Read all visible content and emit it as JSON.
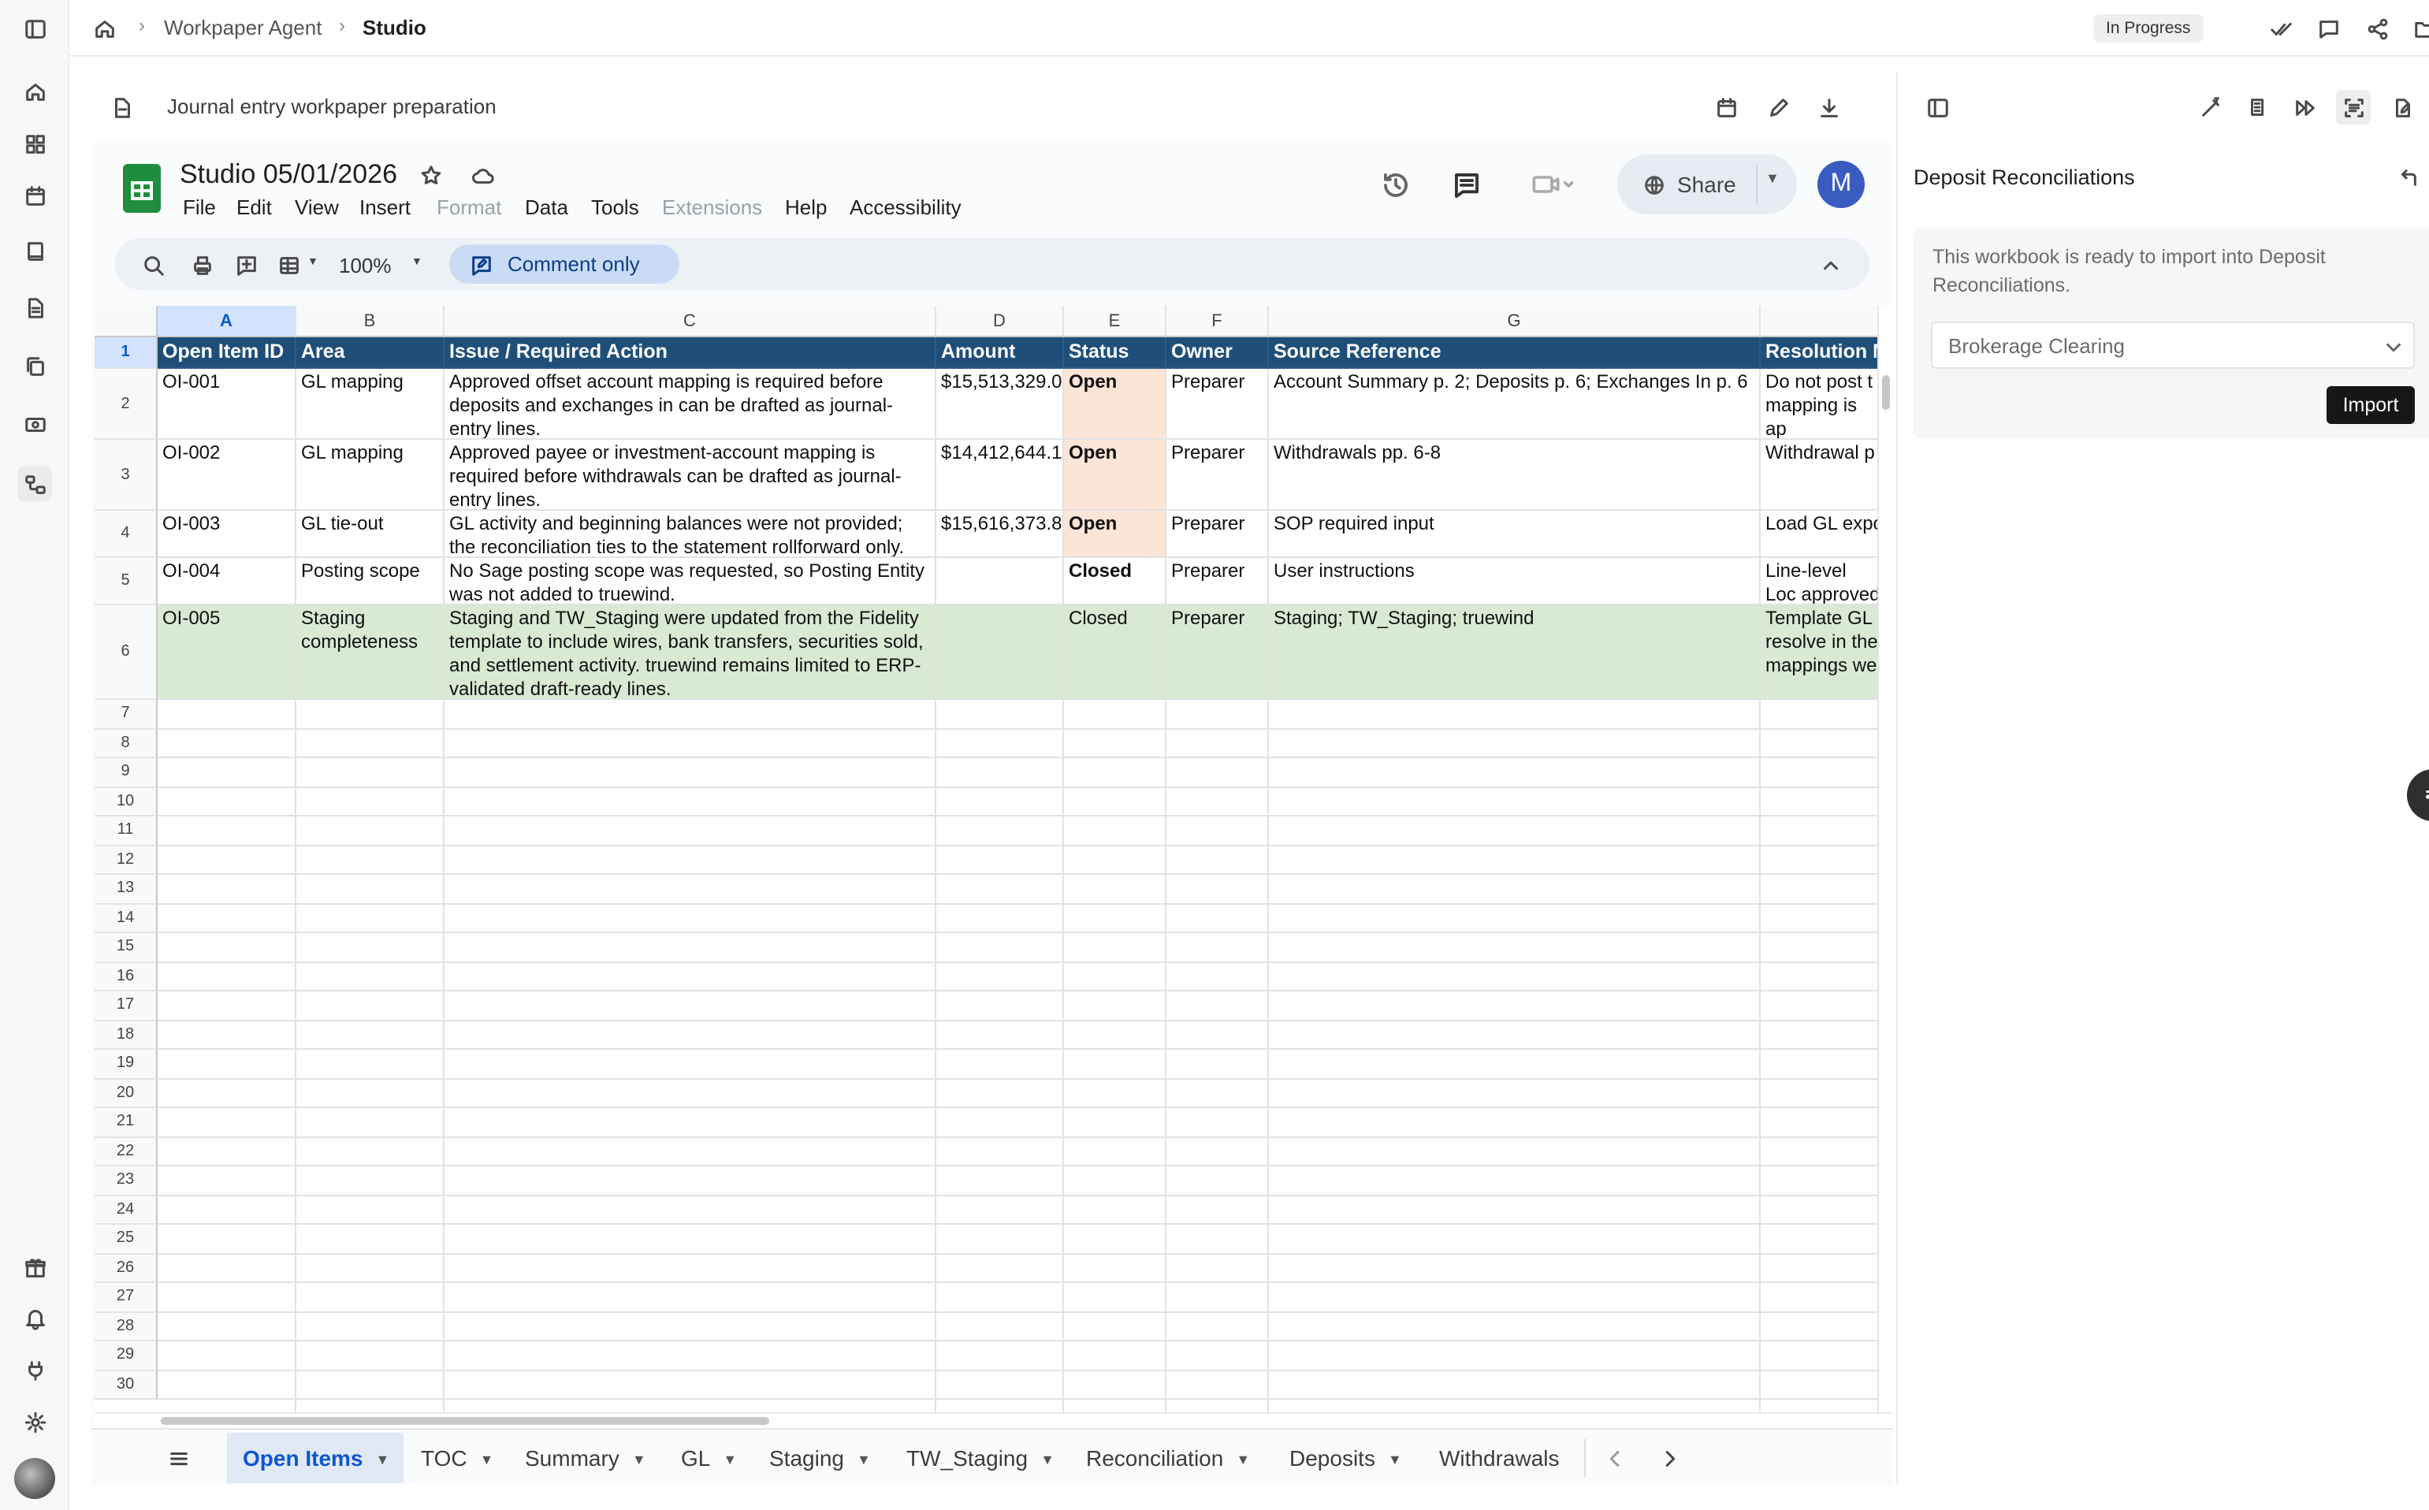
{
  "breadcrumb": {
    "root": "Workpaper Agent",
    "current": "Studio"
  },
  "status": "In Progress",
  "doc": {
    "title": "Journal entry workpaper preparation"
  },
  "sheets": {
    "title": "Studio 05/01/2026",
    "menu": [
      "File",
      "Edit",
      "View",
      "Insert",
      "Format",
      "Data",
      "Tools",
      "Extensions",
      "Help",
      "Accessibility"
    ],
    "share_label": "Share",
    "avatar_initial": "M",
    "zoom": "100%",
    "mode": "Comment only"
  },
  "grid": {
    "columns": [
      "A",
      "B",
      "C",
      "D",
      "E",
      "F",
      "G",
      ""
    ],
    "header_row": [
      "Open Item ID",
      "Area",
      "Issue / Required Action",
      "Amount",
      "Status",
      "Owner",
      "Source Reference",
      "Resolution N"
    ],
    "rows": [
      [
        "OI-001",
        "GL mapping",
        "Approved offset account mapping is required before deposits and exchanges in can be drafted as journal-entry lines.",
        "$15,513,329.0",
        "Open",
        "Preparer",
        "Account Summary p. 2; Deposits p. 6; Exchanges In p. 6",
        "Do not post t mapping is ap"
      ],
      [
        "OI-002",
        "GL mapping",
        "Approved payee or investment-account mapping is required before withdrawals can be drafted as journal-entry lines.",
        "$14,412,644.1",
        "Open",
        "Preparer",
        "Withdrawals pp. 6-8",
        "Withdrawal p"
      ],
      [
        "OI-003",
        "GL tie-out",
        "GL activity and beginning balances were not provided; the reconciliation ties to the statement rollforward only.",
        "$15,616,373.8",
        "Open",
        "Preparer",
        "SOP required input",
        "Load GL expo"
      ],
      [
        "OI-004",
        "Posting scope",
        "No Sage posting scope was requested, so Posting Entity was not added to truewind.",
        "",
        "Closed",
        "Preparer",
        "User instructions",
        "Line-level Loc approved dim"
      ],
      [
        "OI-005",
        "Staging completeness",
        "Staging and TW_Staging were updated from the Fidelity template to include wires, bank transfers, securities sold, and settlement activity. truewind remains limited to ERP-validated draft-ready lines.",
        "",
        "Closed",
        "Preparer",
        "Staging; TW_Staging; truewind",
        "Template GL resolve in the mappings we"
      ]
    ],
    "row_numbers": [
      "1",
      "2",
      "3",
      "4",
      "5",
      "6",
      "7",
      "8",
      "9",
      "10",
      "11",
      "12",
      "13",
      "14",
      "15",
      "16",
      "17",
      "18",
      "19",
      "20",
      "21",
      "22",
      "23",
      "24",
      "25",
      "26",
      "27",
      "28",
      "29",
      "30"
    ]
  },
  "tabs": [
    "Open Items",
    "TOC",
    "Summary",
    "GL",
    "Staging",
    "TW_Staging",
    "Reconciliation",
    "Deposits",
    "Withdrawals"
  ],
  "panel": {
    "title": "Deposit Reconciliations",
    "message": "This workbook is ready to import into Deposit Reconciliations.",
    "select_value": "Brokerage Clearing",
    "import_label": "Import"
  },
  "colors": {
    "header_fill": "#1f4e79",
    "open_fill": "#fce4d6",
    "green_row": "#d9ead3",
    "accent_blue": "#0b57d0"
  }
}
